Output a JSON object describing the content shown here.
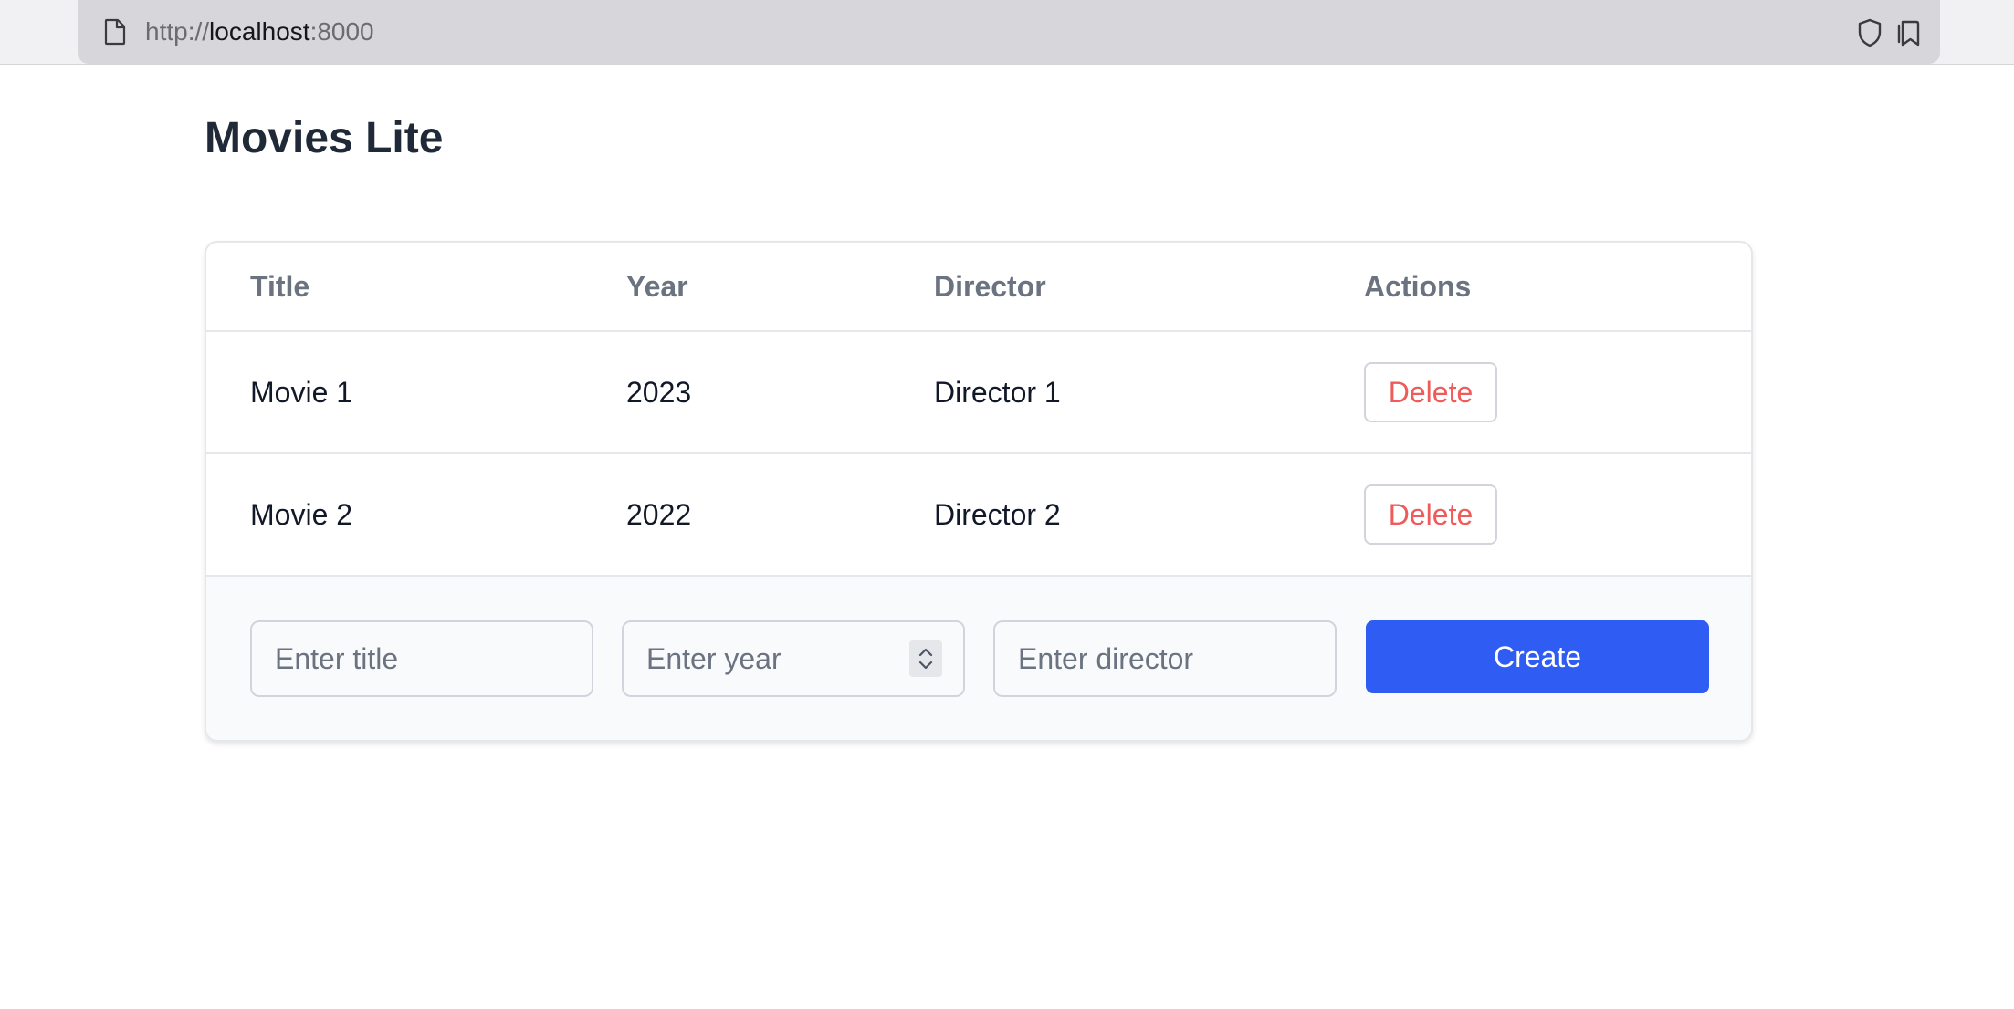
{
  "browser": {
    "url_scheme": "http://",
    "url_host": "localhost",
    "url_port": ":8000",
    "icons": [
      "page-icon",
      "shield-icon",
      "bookmark-icon"
    ]
  },
  "page": {
    "title": "Movies Lite"
  },
  "table": {
    "headers": [
      "Title",
      "Year",
      "Director",
      "Actions"
    ],
    "rows": [
      {
        "title": "Movie 1",
        "year": "2023",
        "director": "Director 1",
        "action": "Delete"
      },
      {
        "title": "Movie 2",
        "year": "2022",
        "director": "Director 2",
        "action": "Delete"
      }
    ]
  },
  "form": {
    "title_placeholder": "Enter title",
    "year_placeholder": "Enter year",
    "director_placeholder": "Enter director",
    "create_label": "Create"
  },
  "colors": {
    "primary": "#2f5cf3",
    "danger": "#ef5b5b",
    "heading": "#1f2937",
    "muted": "#6b7280"
  }
}
